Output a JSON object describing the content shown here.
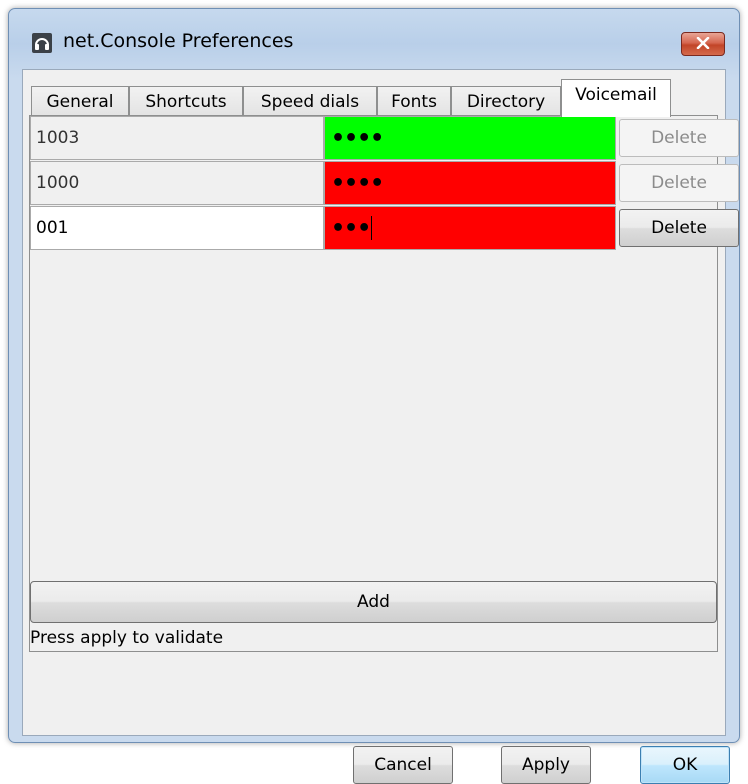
{
  "window": {
    "title": "net.Console Preferences",
    "close_icon": "close-x-icon",
    "app_icon": "headset-icon"
  },
  "tabs": [
    {
      "label": "General",
      "active": false
    },
    {
      "label": "Shortcuts",
      "active": false
    },
    {
      "label": "Speed dials",
      "active": false
    },
    {
      "label": "Fonts",
      "active": false
    },
    {
      "label": "Directory",
      "active": false
    },
    {
      "label": "Voicemail",
      "active": true
    }
  ],
  "voicemail": {
    "rows": [
      {
        "extension": "1003",
        "pin_mask": "••••",
        "pin_status": "valid",
        "pin_color": "#00ff00",
        "delete_label": "Delete",
        "delete_enabled": false,
        "editable": false
      },
      {
        "extension": "1000",
        "pin_mask": "••••",
        "pin_status": "invalid",
        "pin_color": "#ff0000",
        "delete_label": "Delete",
        "delete_enabled": false,
        "editable": false
      },
      {
        "extension": "001",
        "pin_mask": "•••",
        "pin_status": "invalid",
        "pin_color": "#ff0000",
        "delete_label": "Delete",
        "delete_enabled": true,
        "editable": true
      }
    ],
    "add_label": "Add",
    "status_text": "Press apply to validate"
  },
  "footer": {
    "cancel_label": "Cancel",
    "apply_label": "Apply",
    "ok_label": "OK"
  }
}
